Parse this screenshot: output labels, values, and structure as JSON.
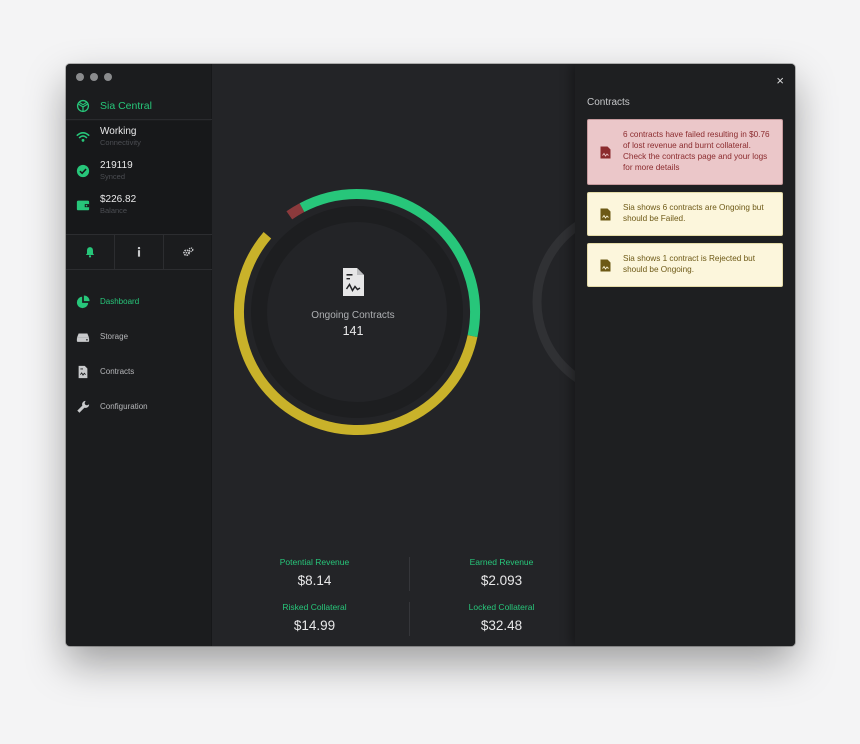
{
  "sidebar": {
    "brand": "Sia Central",
    "status": [
      {
        "value": "Working",
        "label": "Connectivity",
        "icon": "wifi-icon"
      },
      {
        "value": "219119",
        "label": "Synced",
        "icon": "check-circle-icon"
      },
      {
        "value": "$226.82",
        "label": "Balance",
        "icon": "wallet-icon"
      }
    ],
    "tools": [
      "bell-icon",
      "info-icon",
      "gears-icon"
    ],
    "nav": [
      {
        "label": "Dashboard",
        "icon": "pie-chart-icon",
        "active": true
      },
      {
        "label": "Storage",
        "icon": "hard-drive-icon",
        "active": false
      },
      {
        "label": "Contracts",
        "icon": "contract-document-icon",
        "active": false
      },
      {
        "label": "Configuration",
        "icon": "wrench-icon",
        "active": false
      }
    ]
  },
  "main": {
    "donut": {
      "title": "Ongoing Contracts",
      "value": "141",
      "segments": [
        {
          "fraction": 0.36,
          "color": "#27c67a"
        },
        {
          "fraction": 0.58,
          "color": "#c9b22a"
        },
        {
          "fraction": 0.02,
          "color": "#8b3a3c"
        }
      ]
    },
    "stats": [
      {
        "label": "Potential Revenue",
        "value": "$8.14"
      },
      {
        "label": "Earned Revenue",
        "value": "$2.093"
      },
      {
        "label": "Risked Collateral",
        "value": "$14.99"
      },
      {
        "label": "Locked Collateral",
        "value": "$32.48"
      }
    ]
  },
  "panel": {
    "close": "×",
    "title": "Contracts",
    "alerts": [
      {
        "type": "danger",
        "text": "6 contracts have failed resulting in $0.76 of lost revenue and burnt collateral. Check the contracts page and your logs for more details"
      },
      {
        "type": "warning",
        "text": "Sia shows 6 contracts are Ongoing but should be Failed."
      },
      {
        "type": "warning",
        "text": "Sia shows 1 contract is Rejected but should be Ongoing."
      }
    ]
  },
  "colors": {
    "accent": "#27c67a",
    "warning": "#c9b22a",
    "danger": "#8b3a3c",
    "background": "#232427"
  }
}
